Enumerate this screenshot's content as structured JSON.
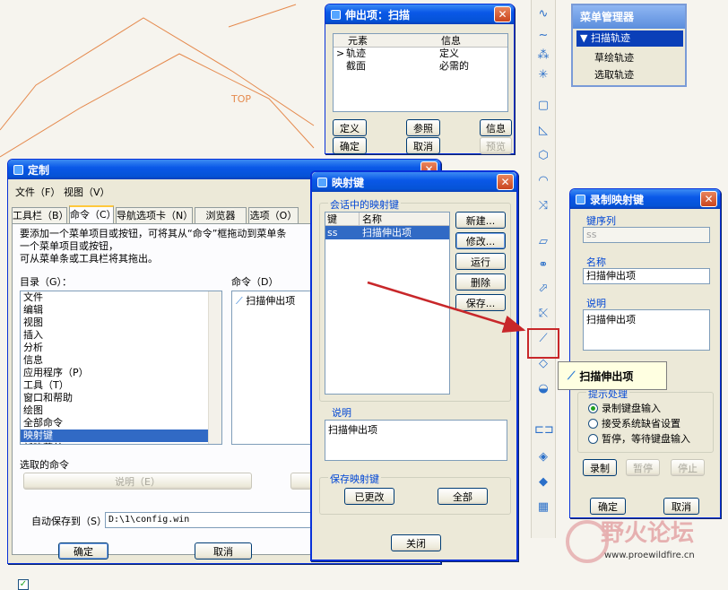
{
  "background": {
    "label_top": "TOP",
    "sketch_color": "#e58a4e"
  },
  "watermark": {
    "name": "野火论坛",
    "url": "www.proewildfire.cn"
  },
  "sweep_dialog": {
    "title": "伸出项：扫描",
    "col_element": "元素",
    "col_info": "信息",
    "rows": [
      {
        "marker": ">",
        "element": "轨迹",
        "info": "定义"
      },
      {
        "marker": "",
        "element": "截面",
        "info": "必需的"
      }
    ],
    "buttons": {
      "define": "定义",
      "reference": "参照",
      "info": "信息",
      "ok": "确定",
      "cancel": "取消",
      "preview": "预览"
    }
  },
  "menu_manager": {
    "title": "菜单管理器",
    "header": "扫描轨迹",
    "items": [
      "草绘轨迹",
      "选取轨迹"
    ]
  },
  "customize": {
    "title": "定制",
    "menu": [
      "文件（F）",
      "视图（V）"
    ],
    "tabs": [
      "工具栏（B）",
      "命令（C）",
      "导航选项卡（N）",
      "浏览器（W）",
      "选项（O）"
    ],
    "description": [
      "要添加一个菜单项目或按钮，可将其从“命令”框拖动到菜单条",
      "一个菜单项目或按钮，",
      "可从菜单条或工具栏将其拖出。"
    ],
    "categories_label": "目录（G）：",
    "categories": [
      "文件",
      "编辑",
      "视图",
      "插入",
      "分析",
      "信息",
      "应用程序（P）",
      "工具（T）",
      "窗口和帮助",
      "绘图",
      "全部命令",
      "映射键",
      "新建菜单"
    ],
    "selected_category": "映射键",
    "commands_label": "命令（D）",
    "commands": [
      "扫描伸出项"
    ],
    "selected_cmd_label": "选取的命令",
    "describe_button": "说明（E）",
    "autosave_label": "自动保存到（S）",
    "autosave_path": "D:\\1\\config.win",
    "ok": "确定",
    "cancel": "取消"
  },
  "mapkeys": {
    "title": "映射键",
    "group_label": "会话中的映射键",
    "col_key": "键",
    "col_name": "名称",
    "rows": [
      {
        "key": "ss",
        "name": "扫描伸出项"
      }
    ],
    "buttons": [
      "新建...",
      "修改...",
      "运行",
      "删除",
      "保存..."
    ],
    "desc_label": "说明",
    "desc_text": "扫描伸出项",
    "save_group": "保存映射键",
    "save_changed": "已更改",
    "save_all": "全部",
    "close": "关闭"
  },
  "record": {
    "title": "录制映射键",
    "keyseq_label": "键序列",
    "keyseq_value": "ss",
    "name_label": "名称",
    "name_value": "扫描伸出项",
    "desc_label": "说明",
    "desc_value": "扫描伸出项",
    "prompt_label": "提示处理",
    "options": [
      "录制键盘输入",
      "接受系统缺省设置",
      "暂停，等待键盘输入"
    ],
    "selected_option": 0,
    "rec_buttons": [
      "录制",
      "暂停",
      "停止"
    ],
    "ok": "确定",
    "cancel": "取消"
  },
  "tooltip": {
    "text": "扫描伸出项"
  },
  "toolbar_icons": [
    "sketch-curve-icon",
    "spline-icon",
    "points-icon",
    "csys-icon",
    "plane-icon",
    "datum-icon",
    "extrude-icon",
    "revolve-icon",
    "variable-sweep-icon",
    "hole-icon",
    "round-icon",
    "chamfer-icon",
    "sweep-icon",
    "sweep-protrusion-icon",
    "blend-icon",
    "shell-icon",
    "mirror-icon",
    "pattern-icon",
    "merge-icon",
    "fill-icon"
  ]
}
